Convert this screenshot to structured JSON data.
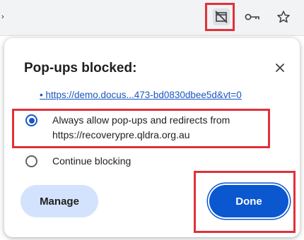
{
  "toolbar": {
    "url_fragment": "›",
    "icons": [
      "popup-blocked-icon",
      "key-icon",
      "star-icon"
    ]
  },
  "dialog": {
    "title": "Pop-ups blocked:",
    "close_icon": "close-icon",
    "blocked_link": "• https://demo.docus...473-bd0830dbee5d&vt=0",
    "options": [
      {
        "label": "Always allow pop-ups and redirects from https://recoverypre.qldra.org.au",
        "selected": true
      },
      {
        "label": "Continue blocking",
        "selected": false
      }
    ],
    "manage_label": "Manage",
    "done_label": "Done"
  },
  "colors": {
    "accent": "#0b57d0",
    "tonal_button": "#d3e3fd",
    "link": "#1a56c2",
    "highlight": "#e0313b"
  }
}
